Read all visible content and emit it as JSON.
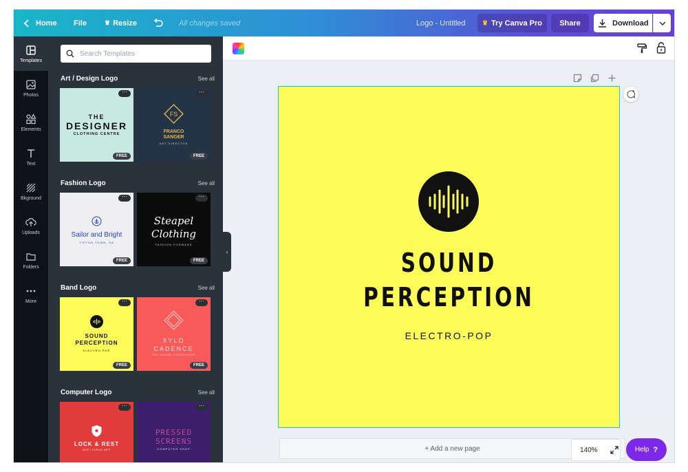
{
  "topbar": {
    "home": "Home",
    "file": "File",
    "resize": "Resize",
    "saved_status": "All changes saved",
    "doc_title": "Logo - Untitled",
    "try_pro": "Try Canva Pro",
    "share": "Share",
    "download": "Download"
  },
  "sidenav": {
    "items": [
      {
        "label": "Templates",
        "icon": "templates-icon"
      },
      {
        "label": "Photos",
        "icon": "photo-icon"
      },
      {
        "label": "Elements",
        "icon": "elements-icon"
      },
      {
        "label": "Text",
        "icon": "text-icon"
      },
      {
        "label": "Bkground",
        "icon": "background-icon"
      },
      {
        "label": "Uploads",
        "icon": "upload-icon"
      },
      {
        "label": "Folders",
        "icon": "folder-icon"
      },
      {
        "label": "More",
        "icon": "more-icon"
      }
    ]
  },
  "panel": {
    "search_placeholder": "Search Templates",
    "see_all": "See all",
    "free_badge": "FREE",
    "sections": [
      {
        "title": "Art / Design Logo",
        "templates": [
          {
            "lines": [
              "THE",
              "DESIGNER",
              "CLOTHING CENTRE"
            ],
            "bg": "#c9e9e3"
          },
          {
            "lines": [
              "FS",
              "FRANCO",
              "SANGER",
              "ART DIRECTOR"
            ],
            "bg": "#243447"
          }
        ]
      },
      {
        "title": "Fashion Logo",
        "templates": [
          {
            "lines": [
              "Sailor and Bright",
              "TIPTON TOWN, SA"
            ],
            "bg": "#efeff2"
          },
          {
            "lines": [
              "Steapel",
              "Clothing",
              "FASHION FORWARD"
            ],
            "bg": "#0b0b0b"
          }
        ]
      },
      {
        "title": "Band Logo",
        "templates": [
          {
            "lines": [
              "SOUND",
              "PERCEPTION",
              "ELECTRO-POP"
            ],
            "bg": "#fdfb57"
          },
          {
            "lines": [
              "XYLO",
              "CADENCE",
              "THE SOUND EXPERIENCE"
            ],
            "bg": "#f85a5a"
          }
        ]
      },
      {
        "title": "Computer Logo",
        "templates": [
          {
            "lines": [
              "LOCK & REST",
              "ANTI VIRUS APP"
            ],
            "bg": "#e23b3b"
          },
          {
            "lines": [
              "PRESSED",
              "SCREENS",
              "COMPUTER SHOP"
            ],
            "bg": "#3d1f6e"
          }
        ]
      }
    ]
  },
  "design": {
    "title_line1": "SOUND",
    "title_line2": "PERCEPTION",
    "subtitle": "ELECTRO-POP",
    "bg_color": "#fdfb57"
  },
  "footer": {
    "add_page": "+ Add a new page",
    "zoom": "140%",
    "help": "Help"
  },
  "colors": {
    "accent_purple": "#7d2ae8",
    "panel_bg": "#2a323c",
    "nav_bg": "#0e1318",
    "selection": "#19c6d8"
  }
}
